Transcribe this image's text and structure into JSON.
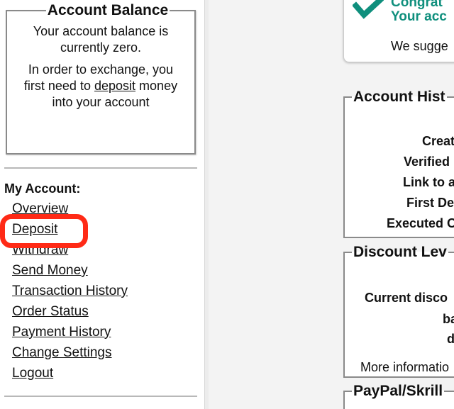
{
  "balance": {
    "legend": "Account Balance",
    "line1": "Your account balance is currently zero.",
    "line2_pre": "In order to exchange, you first need to",
    "line2_link": "deposit",
    "line2_post": "money into your account"
  },
  "my_account": {
    "title": "My Account:",
    "items": [
      {
        "label": "Overview"
      },
      {
        "label": "Deposit"
      },
      {
        "label": "Withdraw"
      },
      {
        "label": "Send Money"
      },
      {
        "label": "Transaction History"
      },
      {
        "label": "Order Status"
      },
      {
        "label": "Payment History"
      },
      {
        "label": "Change Settings"
      },
      {
        "label": "Logout"
      }
    ],
    "highlight_color": "#ff2a16"
  },
  "congrats": {
    "line1": "Congrat",
    "line2": "Your acc",
    "line3": "We sugge",
    "accent_color": "#0f8f7d",
    "icon": "checkmark-icon"
  },
  "account_history": {
    "legend": "Account Hist",
    "rows": [
      "Created",
      "Verified En",
      "Link to ava",
      "First Depo",
      "Executed Ord"
    ]
  },
  "discount": {
    "legend": "Discount Lev",
    "line1": "Current disco",
    "line2": "ba",
    "line3": "d",
    "line4": "More informatio"
  },
  "paypal": {
    "legend": "PayPal/Skrill"
  }
}
